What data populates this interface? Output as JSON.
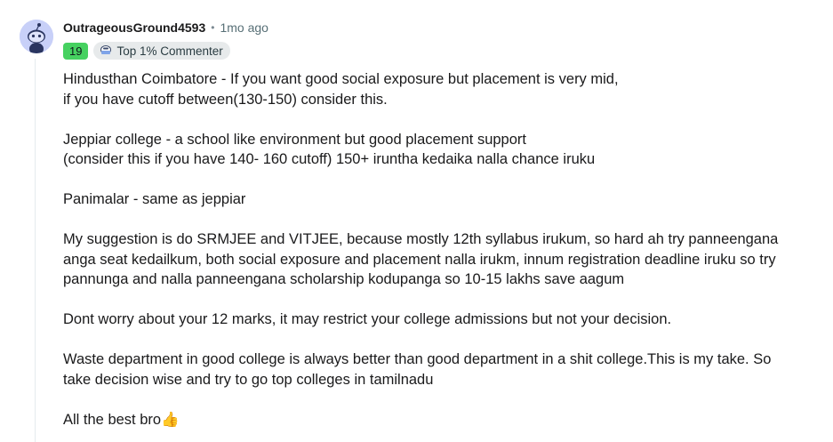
{
  "comment": {
    "author": "OutrageousGround4593",
    "separator": "•",
    "time": "1mo ago",
    "karma_flair": "19",
    "badge_label": "Top 1% Commenter",
    "paragraphs": [
      [
        "Hindusthan Coimbatore - If you want good social exposure but placement is very mid,",
        "if you have cutoff between(130-150) consider this."
      ],
      [
        "Jeppiar college - a school like environment but good placement support",
        "(consider this if you have 140- 160 cutoff) 150+ iruntha kedaika nalla chance iruku"
      ],
      [
        "Panimalar - same as jeppiar"
      ],
      [
        "My suggestion is do SRMJEE and VITJEE, because mostly 12th syllabus irukum, so hard ah try panneengana",
        "anga seat kedailkum, both social exposure and placement nalla irukm, innum registration deadline iruku so try",
        "pannunga and nalla panneengana scholarship kodupanga so 10-15 lakhs save aagum"
      ],
      [
        "Dont worry about your 12 marks, it may restrict your college admissions but not your decision."
      ],
      [
        "Waste department in good college is always better than good department in a shit college.This is my take. So",
        "take decision wise and try to go top colleges in tamilnadu"
      ],
      [
        "All the best bro👍"
      ]
    ]
  },
  "colors": {
    "karma_green": "#46d160",
    "avatar_bg": "#c8d0f8",
    "badge_bg": "#e7eaeb"
  },
  "icons": {
    "avatar": "reddit-snoo-avatar-icon",
    "badge": "top-commenter-badge-icon"
  }
}
